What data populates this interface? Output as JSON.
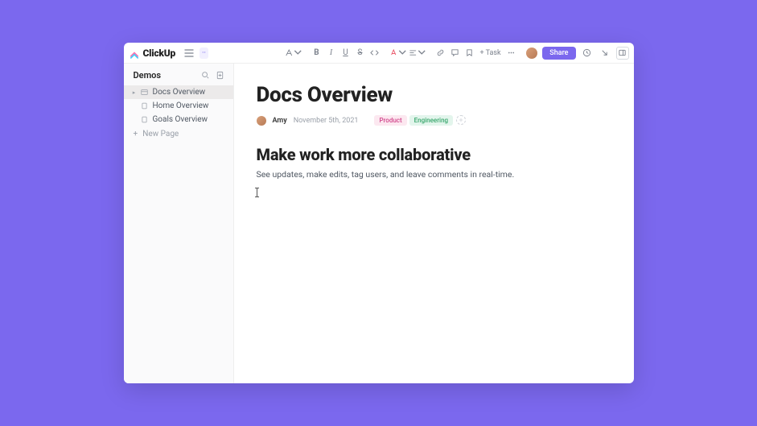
{
  "header": {
    "logo_text": "ClickUp",
    "mode_chip": "··",
    "task_label": "Task",
    "share_label": "Share"
  },
  "sidebar": {
    "title": "Demos",
    "items": [
      {
        "label": "Docs Overview",
        "active": true,
        "has_caret": true,
        "icon": "doc"
      },
      {
        "label": "Home Overview",
        "active": false,
        "has_caret": false,
        "icon": "page"
      },
      {
        "label": "Goals Overview",
        "active": false,
        "has_caret": false,
        "icon": "page"
      }
    ],
    "new_page_label": "New Page"
  },
  "doc": {
    "title": "Docs Overview",
    "author": "Amy",
    "date": "November 5th, 2021",
    "tags": [
      "Product",
      "Engineering"
    ],
    "heading": "Make work more collaborative",
    "body": "See updates, make edits, tag users, and leave comments in real-time."
  }
}
